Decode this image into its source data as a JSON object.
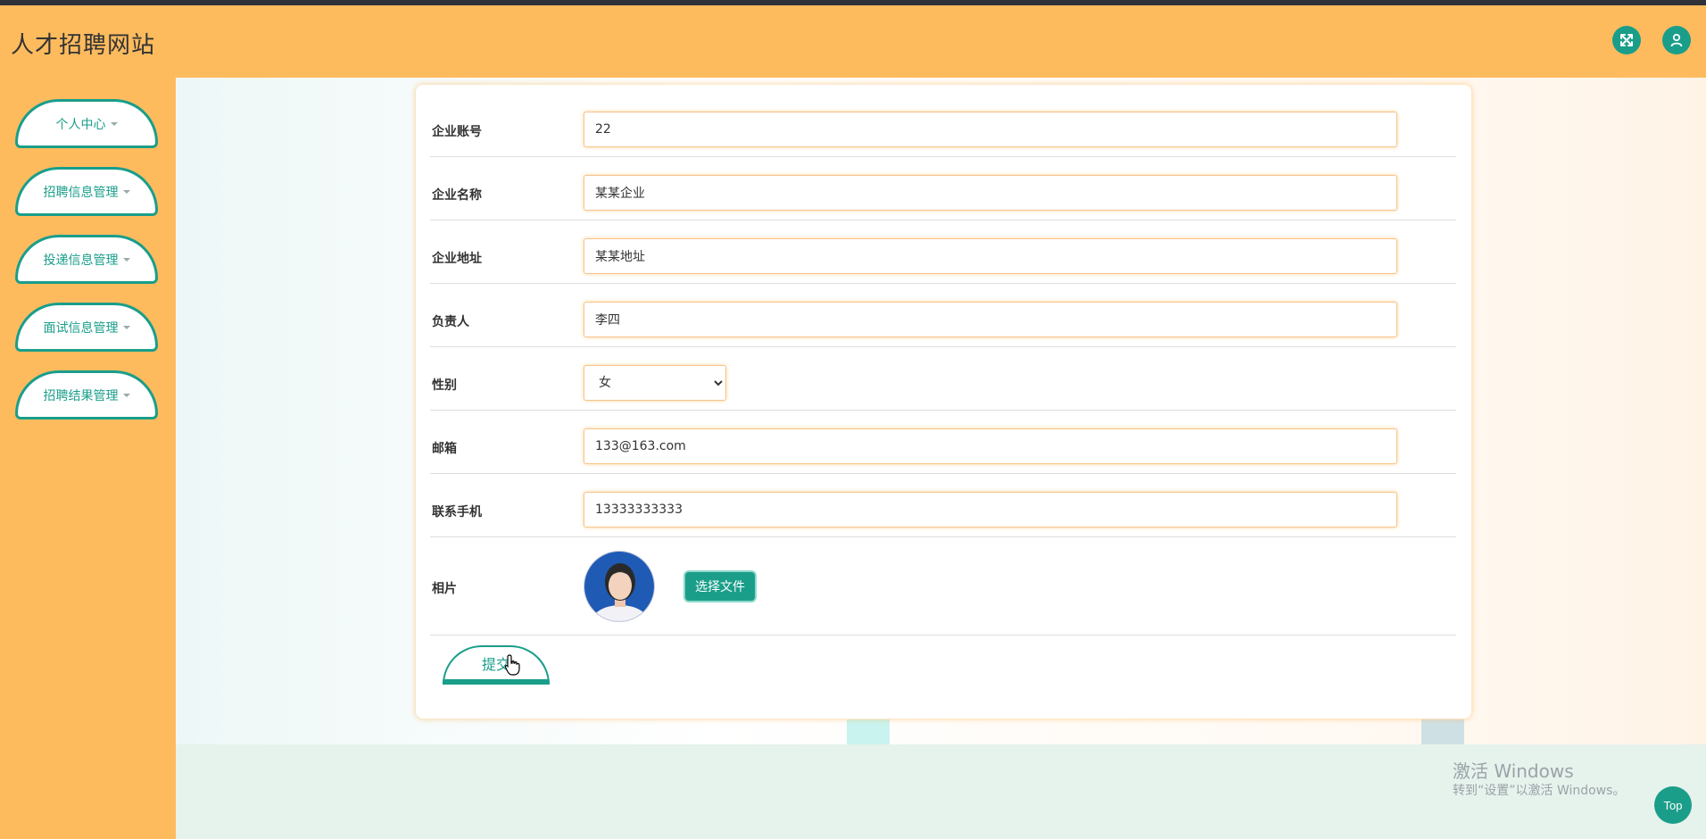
{
  "app": {
    "title": "人才招聘网站"
  },
  "header": {
    "fullscreen_icon": "fullscreen-icon",
    "user_icon": "user-icon"
  },
  "sidebar": {
    "items": [
      {
        "label": "个人中心"
      },
      {
        "label": "招聘信息管理"
      },
      {
        "label": "投递信息管理"
      },
      {
        "label": "面试信息管理"
      },
      {
        "label": "招聘结果管理"
      }
    ]
  },
  "form": {
    "account": {
      "label": "企业账号",
      "value": "22"
    },
    "name": {
      "label": "企业名称",
      "value": "某某企业"
    },
    "address": {
      "label": "企业地址",
      "value": "某某地址"
    },
    "contact": {
      "label": "负责人",
      "value": "李四"
    },
    "gender": {
      "label": "性别",
      "value": "女"
    },
    "email": {
      "label": "邮箱",
      "value": "133@163.com"
    },
    "phone": {
      "label": "联系手机",
      "value": "13333333333"
    },
    "photo": {
      "label": "相片",
      "choose_file": "选择文件"
    },
    "submit_label": "提交"
  },
  "watermark": {
    "line1": "激活 Windows",
    "line2": "转到“设置”以激活 Windows。"
  },
  "back_to_top": "Top",
  "colors": {
    "accent": "#1a9e8a",
    "header": "#febb5e"
  }
}
